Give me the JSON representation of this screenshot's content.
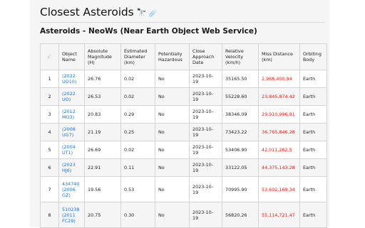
{
  "header": {
    "title": "Closest Asteroids",
    "title_icons": "🔭 ☄️",
    "subtitle": "Asteroids - NeoWs (Near Earth Object Web Service)"
  },
  "table": {
    "sort_icon": "☄",
    "columns": [
      "Object Name",
      "Absolute Magnitude (H)",
      "Estimated Diameter (km)",
      "Potentially Hazardous",
      "Close Approach Date",
      "Relative Velocity (km/h)",
      "Miss Distance (km)",
      "Orbiting Body"
    ],
    "rows": [
      {
        "index": "1",
        "name": "(2022 UO10)",
        "magnitude": "26.76",
        "diameter": "0.02",
        "hazardous": "No",
        "date": "2023-10-19",
        "velocity": "35165.50",
        "miss": "2,968,400.94",
        "body": "Earth"
      },
      {
        "index": "2",
        "name": "(2022 UO)",
        "magnitude": "26.53",
        "diameter": "0.02",
        "hazardous": "No",
        "date": "2023-10-19",
        "velocity": "55228.60",
        "miss": "23,845,874.42",
        "body": "Earth"
      },
      {
        "index": "3",
        "name": "(2012 MO3)",
        "magnitude": "20.83",
        "diameter": "0.29",
        "hazardous": "No",
        "date": "2023-10-19",
        "velocity": "38346.09",
        "miss": "29,910,996.91",
        "body": "Earth"
      },
      {
        "index": "4",
        "name": "(2008 UG7)",
        "magnitude": "21.19",
        "diameter": "0.25",
        "hazardous": "No",
        "date": "2023-10-19",
        "velocity": "73423.22",
        "miss": "36,765,846.28",
        "body": "Earth"
      },
      {
        "index": "5",
        "name": "(2004 UT1)",
        "magnitude": "26.69",
        "diameter": "0.02",
        "hazardous": "No",
        "date": "2023-10-19",
        "velocity": "53406.90",
        "miss": "42,011,262.5",
        "body": "Earth"
      },
      {
        "index": "6",
        "name": "(2023 HJ6)",
        "magnitude": "22.91",
        "diameter": "0.11",
        "hazardous": "No",
        "date": "2023-10-19",
        "velocity": "33122.05",
        "miss": "44,375,143.28",
        "body": "Earth"
      },
      {
        "index": "7",
        "name": "434740 (2006 GZ)",
        "magnitude": "19.56",
        "diameter": "0.53",
        "hazardous": "No",
        "date": "2023-10-19",
        "velocity": "70995.90",
        "miss": "53,602,169.34",
        "body": "Earth"
      },
      {
        "index": "8",
        "name": "510238 (2011 FC29)",
        "magnitude": "20.75",
        "diameter": "0.30",
        "hazardous": "No",
        "date": "2023-10-19",
        "velocity": "56820.26",
        "miss": "55,114,721.47",
        "body": "Earth"
      }
    ]
  },
  "colors": {
    "link": "#1f73d1",
    "miss_distance": "#e0201b",
    "panel_background": "#f5f5f5"
  }
}
